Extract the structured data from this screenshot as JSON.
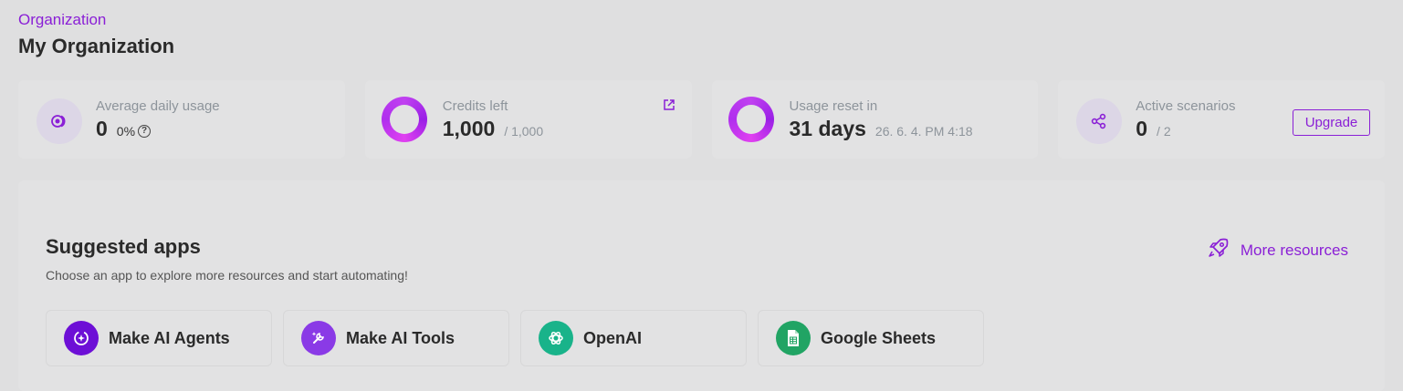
{
  "header": {
    "breadcrumb": "Organization",
    "title": "My Organization"
  },
  "stats": {
    "daily_usage": {
      "label": "Average daily usage",
      "value": "0",
      "percent": "0%"
    },
    "credits": {
      "label": "Credits left",
      "value": "1,000",
      "total": "/ 1,000"
    },
    "reset": {
      "label": "Usage reset in",
      "value": "31 days",
      "date": "26. 6. 4. PM 4:18"
    },
    "scenarios": {
      "label": "Active scenarios",
      "value": "0",
      "total": "/ 2",
      "upgrade_label": "Upgrade"
    }
  },
  "apps": {
    "title": "Suggested apps",
    "subtitle": "Choose an app to explore more resources and start automating!",
    "more_resources": "More resources",
    "items": [
      {
        "name": "Make AI Agents",
        "icon": "ai-agents-icon",
        "color": "#6d0fd6"
      },
      {
        "name": "Make AI Tools",
        "icon": "ai-tools-icon",
        "color": "#8a3ae6"
      },
      {
        "name": "OpenAI",
        "icon": "openai-icon",
        "color": "#19b38a"
      },
      {
        "name": "Google Sheets",
        "icon": "google-sheets-icon",
        "color": "#21a464"
      }
    ]
  },
  "colors": {
    "accent": "#8a1fd6",
    "background": "#dfdfe0",
    "card": "#e2e2e3"
  }
}
